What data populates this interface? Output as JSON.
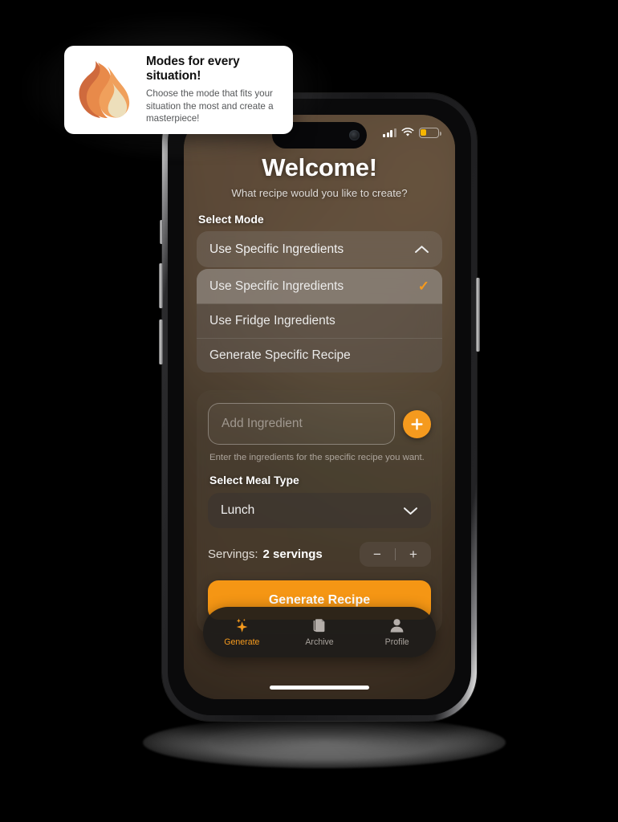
{
  "tooltip": {
    "icon": "flame-icon",
    "title": "Modes for every situation!",
    "body": "Choose the mode that fits your situation the most and create a masterpiece!"
  },
  "status_bar": {
    "cellular": "signal-bars-icon",
    "wifi": "wifi-icon",
    "battery": "battery-low-icon",
    "battery_level_pct": 34,
    "battery_color": "#f5b500"
  },
  "screen": {
    "title": "Welcome!",
    "subtitle": "What recipe would you like to create?",
    "mode": {
      "label": "Select Mode",
      "selected": "Use Specific Ingredients",
      "expanded": true,
      "chevron": "chevron-up-icon",
      "options": [
        {
          "label": "Use Specific Ingredients",
          "selected": true,
          "check": "✓"
        },
        {
          "label": "Use Fridge Ingredients",
          "selected": false,
          "check": ""
        },
        {
          "label": "Generate Specific Recipe",
          "selected": false,
          "check": ""
        }
      ]
    },
    "ingredient": {
      "placeholder": "Add Ingredient",
      "value": "",
      "add_button": "+",
      "hint": "Enter the ingredients for the specific recipe you want."
    },
    "meal": {
      "label": "Select Meal Type",
      "selected": "Lunch",
      "chevron": "chevron-down-icon"
    },
    "servings": {
      "label": "Servings:",
      "value": "2 servings",
      "decrement": "−",
      "increment": "+"
    },
    "generate_button": "Generate Recipe",
    "tabs": [
      {
        "label": "Generate",
        "icon": "sparkles-icon",
        "active": true
      },
      {
        "label": "Archive",
        "icon": "documents-icon",
        "active": false
      },
      {
        "label": "Profile",
        "icon": "person-icon",
        "active": false
      }
    ]
  },
  "colors": {
    "accent": "#f59a1e",
    "generate_button": "#f59614",
    "tab_inactive": "#a8a29c",
    "card_bg": "#ffffff",
    "page_bg": "#000000"
  }
}
